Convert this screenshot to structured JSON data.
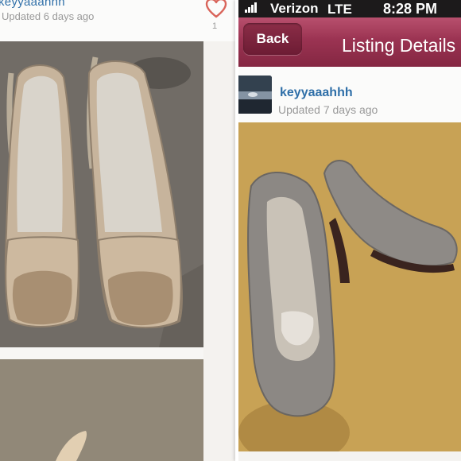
{
  "left_listing": {
    "username": "keyyaaahhh",
    "updated": "Updated 6 days ago",
    "like_count": "1",
    "like_icon": "heart-outline-icon",
    "accent_color": "#d9645a",
    "username_color": "#2f6fa8"
  },
  "right_listing": {
    "status_bar": {
      "carrier": "Verizon",
      "network": "LTE",
      "time": "8:28 PM",
      "signal_icon": "signal-bars-icon"
    },
    "nav": {
      "back_label": "Back",
      "title": "Listing Details",
      "nav_color": "#9b3352"
    },
    "seller": {
      "username": "keyyaaahhh",
      "updated": "Updated 7 days ago"
    }
  }
}
